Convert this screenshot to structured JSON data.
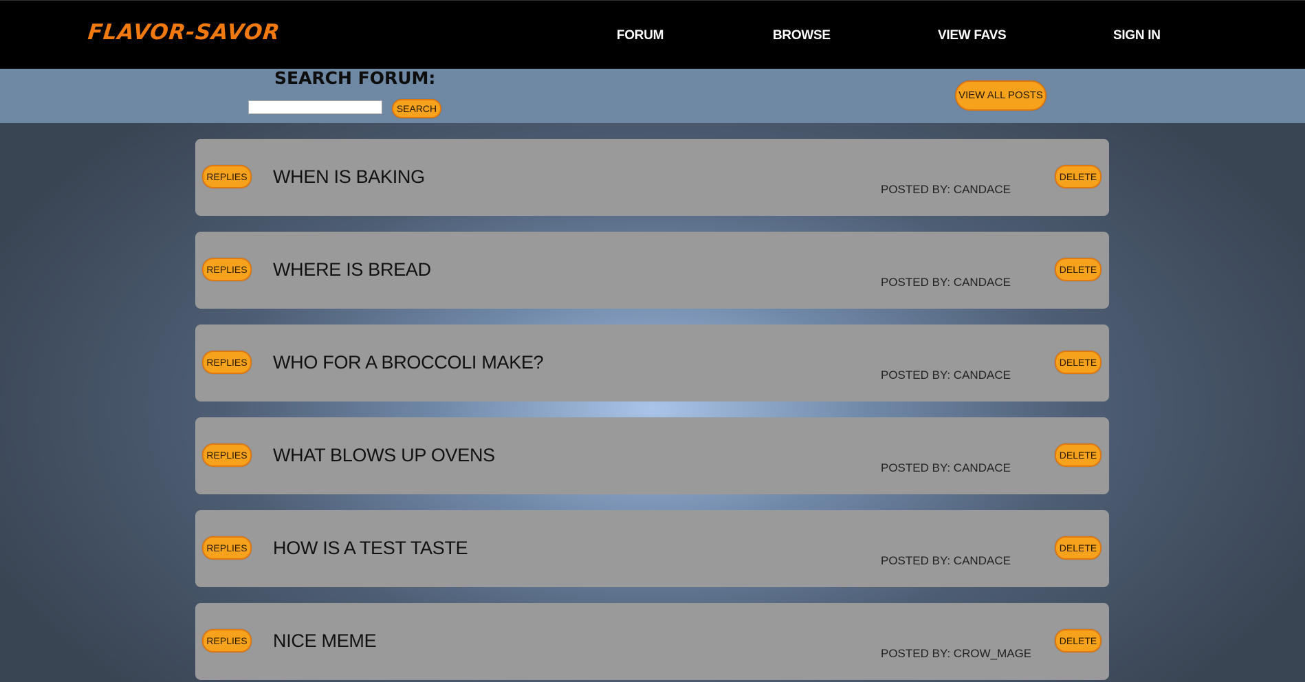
{
  "header": {
    "logo": "FLAVOR-SAVOR",
    "nav": [
      {
        "label": "FORUM"
      },
      {
        "label": "BROWSE"
      },
      {
        "label": "VIEW FAVS"
      },
      {
        "label": "SIGN IN"
      }
    ]
  },
  "search": {
    "title": "SEARCH FORUM:",
    "input_value": "",
    "search_label": "SEARCH",
    "view_all_label": "VIEW ALL POSTS"
  },
  "posts": [
    {
      "title": "WHEN IS BAKING",
      "author": "POSTED BY: CANDACE",
      "replies_label": "REPLIES",
      "delete_label": "DELETE"
    },
    {
      "title": "WHERE IS BREAD",
      "author": "POSTED BY: CANDACE",
      "replies_label": "REPLIES",
      "delete_label": "DELETE"
    },
    {
      "title": "WHO FOR A BROCCOLI MAKE?",
      "author": "POSTED BY: CANDACE",
      "replies_label": "REPLIES",
      "delete_label": "DELETE"
    },
    {
      "title": "WHAT BLOWS UP OVENS",
      "author": "POSTED BY: CANDACE",
      "replies_label": "REPLIES",
      "delete_label": "DELETE"
    },
    {
      "title": "HOW IS A TEST TASTE",
      "author": "POSTED BY: CANDACE",
      "replies_label": "REPLIES",
      "delete_label": "DELETE"
    },
    {
      "title": "NICE MEME",
      "author": "POSTED BY: CROW_MAGE",
      "replies_label": "REPLIES",
      "delete_label": "DELETE"
    }
  ],
  "colors": {
    "header_bg": "#000000",
    "logo": "#f07a10",
    "search_bar_bg": "#6f88a3",
    "button_bg": "#f7a21c",
    "card_bg": "#9a9a9a"
  }
}
